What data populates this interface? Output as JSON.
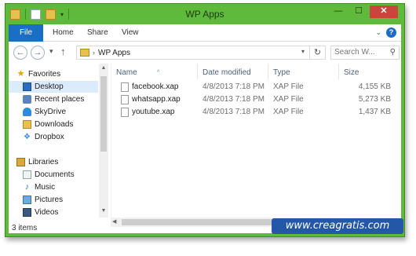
{
  "window": {
    "title": "WP Apps",
    "win_buttons": {
      "minimize": "—",
      "maximize": "☐",
      "close": "✕"
    }
  },
  "ribbon": {
    "tabs": [
      "File",
      "Home",
      "Share",
      "View"
    ],
    "help": "?"
  },
  "address": {
    "path": "WP Apps",
    "search_placeholder": "Search W..."
  },
  "sidebar": {
    "groups": [
      {
        "label": "Favorites",
        "items": [
          "Desktop",
          "Recent places",
          "SkyDrive",
          "Downloads",
          "Dropbox"
        ]
      },
      {
        "label": "Libraries",
        "items": [
          "Documents",
          "Music",
          "Pictures",
          "Videos"
        ]
      }
    ],
    "selected_item": "Desktop"
  },
  "columns": [
    "Name",
    "Date modified",
    "Type",
    "Size"
  ],
  "files": [
    {
      "name": "facebook.xap",
      "date": "4/8/2013 7:18 PM",
      "type": "XAP File",
      "size": "4,155 KB"
    },
    {
      "name": "whatsapp.xap",
      "date": "4/8/2013 7:18 PM",
      "type": "XAP File",
      "size": "5,273 KB"
    },
    {
      "name": "youtube.xap",
      "date": "4/8/2013 7:18 PM",
      "type": "XAP File",
      "size": "1,437 KB"
    }
  ],
  "status": {
    "item_count": "3 items"
  },
  "watermark": "www.creagratis.com",
  "colors": {
    "frame": "#5fb93a",
    "file_tab": "#1a6fc4",
    "selection": "#dcebfc",
    "close_button": "#c9463d",
    "watermark_bg": "#2357a8"
  }
}
